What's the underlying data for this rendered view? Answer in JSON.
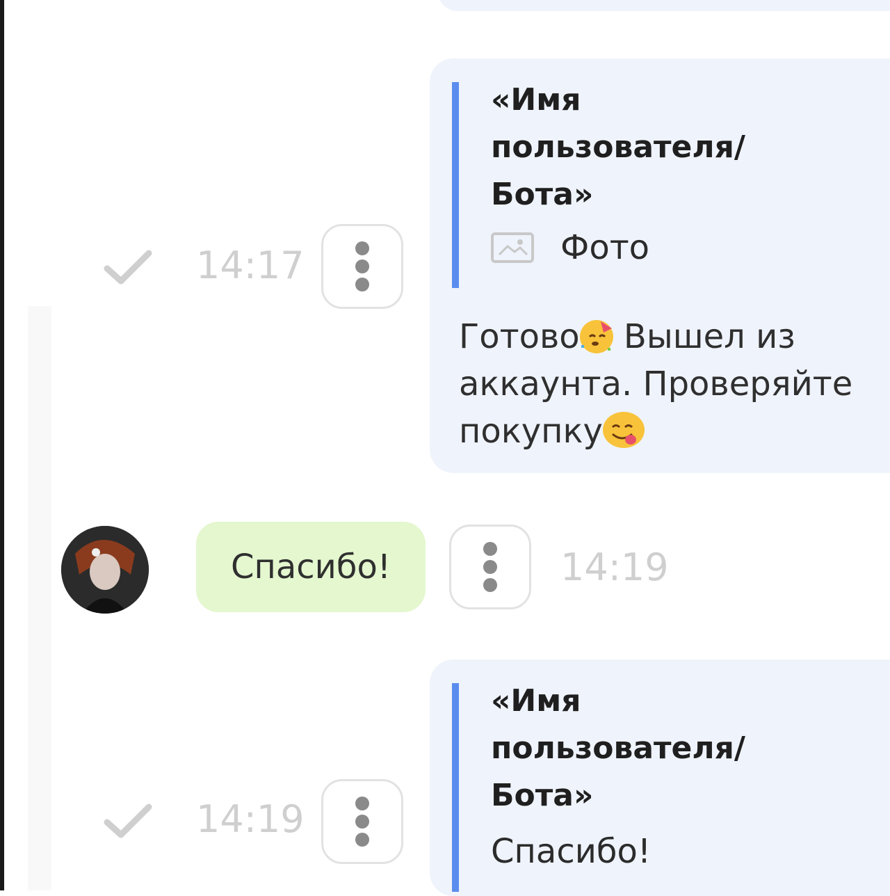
{
  "messages": [
    {
      "quote": {
        "name": "«Имя пользователя/ Бота»",
        "media_label": "Фото",
        "media_icon": "photo-icon"
      },
      "text_part1": "Готово",
      "text_part2": " Вышел из аккаунта. Проверяйте покупку",
      "emoji1": "partying-face-emoji",
      "emoji2": "yum-face-emoji",
      "time": "14:17",
      "status": "check-icon"
    },
    {
      "incoming_text": "Спасибо!",
      "time": "14:19"
    },
    {
      "quote": {
        "name": "«Имя пользователя/ Бота»",
        "text": "Спасибо!"
      },
      "time": "14:19",
      "status": "check-icon"
    }
  ],
  "colors": {
    "outgoing_bubble": "#eff3fb",
    "incoming_bubble": "#e4f7cf",
    "quote_bar": "#5b8def",
    "timestamp": "#cfcfcf"
  }
}
